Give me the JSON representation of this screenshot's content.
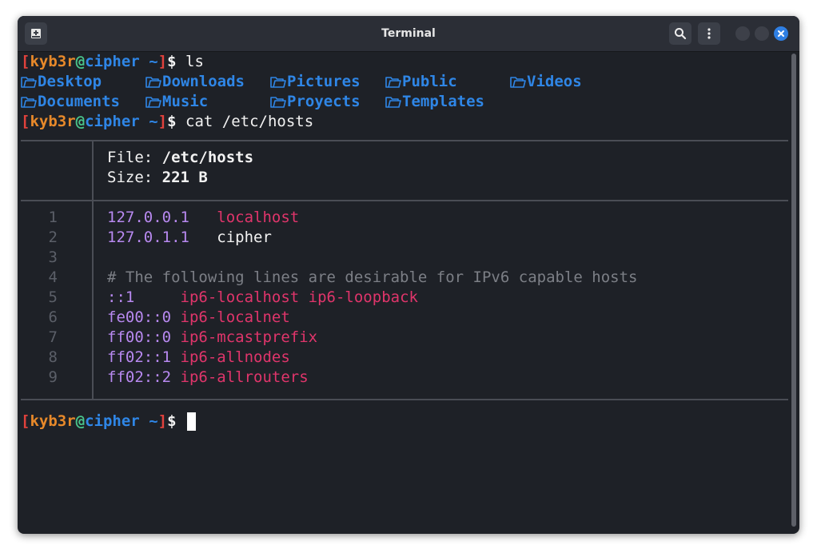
{
  "window": {
    "title": "Terminal"
  },
  "titlebar": {
    "new_tab_icon": "new-tab-icon",
    "search_icon": "search-icon",
    "menu_icon": "kebab-menu-icon",
    "close_icon": "close-icon"
  },
  "prompt": {
    "open": "[",
    "user": "kyb3r",
    "at": "@",
    "host": "cipher",
    "path": " ~",
    "close": "]",
    "sign": "$"
  },
  "commands": [
    "ls",
    "cat /etc/hosts"
  ],
  "ls_output": [
    [
      "Desktop",
      "Downloads",
      "Pictures",
      "Public",
      "Videos"
    ],
    [
      "Documents",
      "Music",
      "Proyects",
      "Templates"
    ]
  ],
  "file_header": {
    "file_label": "File: ",
    "file_value": "/etc/hosts",
    "size_label": "Size: ",
    "size_value": "221 B"
  },
  "hosts_lines": [
    {
      "n": "1",
      "addr": "127.0.0.1",
      "sep": "   ",
      "names": "localhost",
      "style": "pink"
    },
    {
      "n": "2",
      "addr": "127.0.1.1",
      "sep": "   ",
      "names": "cipher",
      "style": "white"
    },
    {
      "n": "3",
      "addr": "",
      "sep": "",
      "names": "",
      "style": "white"
    },
    {
      "n": "4",
      "comment": "# The following lines are desirable for IPv6 capable hosts"
    },
    {
      "n": "5",
      "addr": "::1",
      "sep": "     ",
      "names": "ip6-localhost ip6-loopback",
      "style": "pink"
    },
    {
      "n": "6",
      "addr": "fe00::0",
      "sep": " ",
      "names": "ip6-localnet",
      "style": "pink"
    },
    {
      "n": "7",
      "addr": "ff00::0",
      "sep": " ",
      "names": "ip6-mcastprefix",
      "style": "pink"
    },
    {
      "n": "8",
      "addr": "ff02::1",
      "sep": " ",
      "names": "ip6-allnodes",
      "style": "pink"
    },
    {
      "n": "9",
      "addr": "ff02::2",
      "sep": " ",
      "names": "ip6-allrouters",
      "style": "pink"
    }
  ],
  "colors": {
    "user": "#e7892a",
    "at": "#49c38a",
    "host": "#2f86e6",
    "bracket": "#e0413c",
    "directory": "#2f86e6",
    "ip": "#b889f0",
    "hostname": "#e0356b"
  }
}
